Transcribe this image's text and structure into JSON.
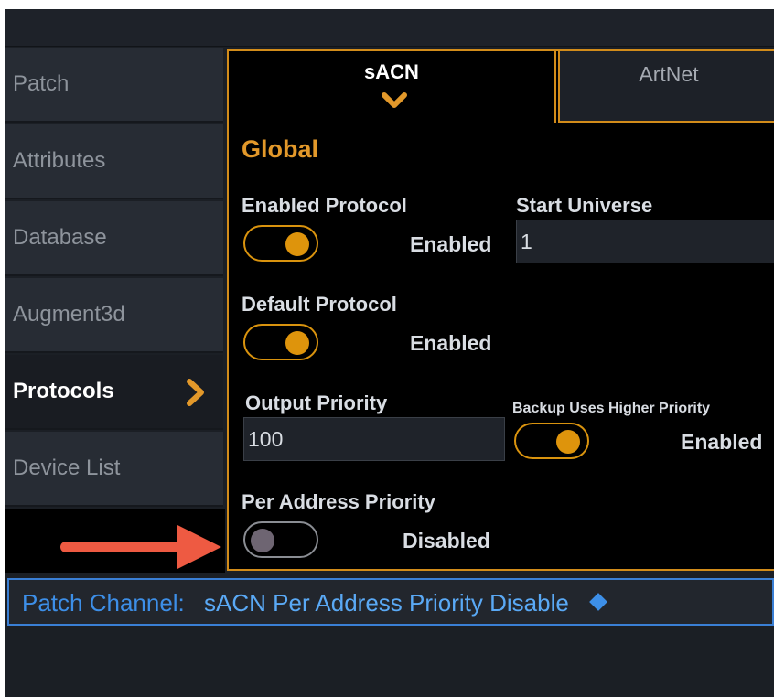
{
  "colors": {
    "accent": "#d28c1a",
    "toggle_on": "#de940c",
    "command_blue": "#3d8fe8",
    "annotation_arrow": "#ee5a42"
  },
  "sidebar": {
    "items": [
      {
        "label": "Patch",
        "active": false
      },
      {
        "label": "Attributes",
        "active": false
      },
      {
        "label": "Database",
        "active": false
      },
      {
        "label": "Augment3d",
        "active": false
      },
      {
        "label": "Protocols",
        "active": true,
        "icon": "chevron-right-icon"
      },
      {
        "label": "Device List",
        "active": false
      }
    ]
  },
  "tabs": [
    {
      "label": "sACN",
      "active": true,
      "icon": "chevron-down-icon"
    },
    {
      "label": "ArtNet",
      "active": false
    }
  ],
  "section": {
    "title": "Global"
  },
  "settings": {
    "enabled_protocol": {
      "label": "Enabled Protocol",
      "state": "on",
      "value": "Enabled"
    },
    "start_universe": {
      "label": "Start Universe",
      "value": "1"
    },
    "default_protocol": {
      "label": "Default Protocol",
      "state": "on",
      "value": "Enabled"
    },
    "output_priority": {
      "label": "Output Priority",
      "value": "100"
    },
    "backup_priority": {
      "label": "Backup Uses Higher Priority",
      "state": "on",
      "value": "Enabled"
    },
    "per_address_priority": {
      "label": "Per Address Priority",
      "state": "off",
      "value": "Disabled"
    }
  },
  "command_line": {
    "prefix": "Patch Channel:",
    "text": "sACN Per Address Priority Disable",
    "icon": "diamond-icon"
  },
  "annotation": {
    "icon": "red-arrow-icon"
  }
}
